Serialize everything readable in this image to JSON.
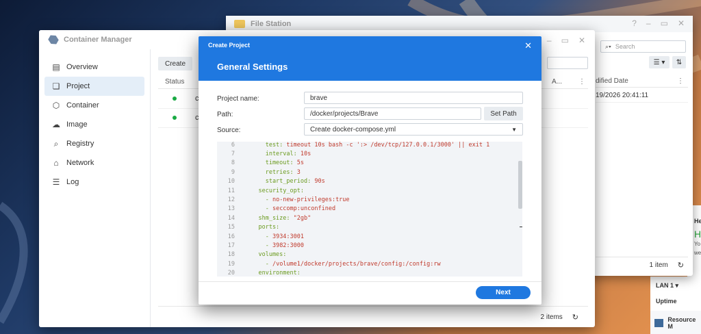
{
  "colors": {
    "accent": "#1f78e0",
    "status_running": "#1aaa44"
  },
  "file_station": {
    "title": "File Station",
    "search_placeholder": "Search",
    "col_modified": "dified Date",
    "row_modified": "19/2026 20:41:11",
    "footer_count": "1 item"
  },
  "widgets": {
    "he": "He",
    "h": "H",
    "yo": "Yo",
    "we": "we",
    "lan": "LAN 1 ▾",
    "uptime": "Uptime",
    "resource": "Resource M"
  },
  "container_manager": {
    "title": "Container Manager",
    "nav": [
      {
        "label": "Overview",
        "icon": "overview-icon"
      },
      {
        "label": "Project",
        "icon": "project-icon"
      },
      {
        "label": "Container",
        "icon": "container-icon"
      },
      {
        "label": "Image",
        "icon": "image-icon"
      },
      {
        "label": "Registry",
        "icon": "registry-icon"
      },
      {
        "label": "Network",
        "icon": "network-icon"
      },
      {
        "label": "Log",
        "icon": "log-icon"
      }
    ],
    "create_label": "Create",
    "col_status": "Status",
    "col_a": "A...",
    "row_initials": [
      "c",
      "c"
    ],
    "footer_count": "2 items"
  },
  "dialog": {
    "title": "Create Project",
    "subtitle": "General Settings",
    "project_name_label": "Project name:",
    "project_name_value": "brave",
    "path_label": "Path:",
    "path_value": "/docker/projects/Brave",
    "set_path_label": "Set Path",
    "source_label": "Source:",
    "source_value": "Create docker-compose.yml",
    "code_lines": [
      {
        "n": "6",
        "key": "      test: ",
        "val": "timeout 10s bash -c ':> /dev/tcp/127.0.0.1/3000' || exit 1"
      },
      {
        "n": "7",
        "key": "      interval: ",
        "val": "10s"
      },
      {
        "n": "8",
        "key": "      timeout: ",
        "val": "5s"
      },
      {
        "n": "9",
        "key": "      retries: ",
        "val": "3"
      },
      {
        "n": "10",
        "key": "      start_period: ",
        "val": "90s"
      },
      {
        "n": "11",
        "key": "    security_opt:",
        "val": ""
      },
      {
        "n": "12",
        "key": "      - ",
        "val": "no-new-privileges:true"
      },
      {
        "n": "13",
        "key": "      - ",
        "val": "seccomp:unconfined"
      },
      {
        "n": "14",
        "key": "    shm_size: ",
        "val": "\"2gb\""
      },
      {
        "n": "15",
        "key": "    ports:",
        "val": ""
      },
      {
        "n": "16",
        "key": "      - ",
        "val": "3934:3001"
      },
      {
        "n": "17",
        "key": "      - ",
        "val": "3982:3000"
      },
      {
        "n": "18",
        "key": "    volumes:",
        "val": ""
      },
      {
        "n": "19",
        "key": "      - ",
        "val": "/volume1/docker/projects/brave/config:/config:rw"
      },
      {
        "n": "20",
        "key": "    environment:",
        "val": ""
      }
    ],
    "next_label": "Next"
  }
}
